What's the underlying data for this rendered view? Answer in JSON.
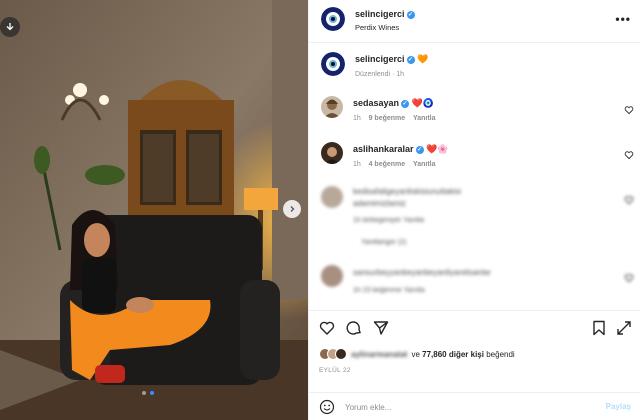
{
  "post": {
    "owner": "selincigerci",
    "location": "Perdix Wines",
    "verified": true
  },
  "caption": {
    "username": "selincigerci",
    "emoji": "🧡",
    "edited_label": "Düzenlendi · 1h"
  },
  "comments": [
    {
      "username": "sedasayan",
      "emoji": "❤️🧿",
      "time": "1h",
      "likes": "9 beğenme",
      "reply": "Yanıtla"
    },
    {
      "username": "aslihankaralar",
      "emoji": "❤️🌸",
      "time": "1h",
      "likes": "4 beğenme",
      "reply": "Yanıtla"
    }
  ],
  "blurred_comments": [
    {
      "line1": "kedisafaligeyanliskisiunuttakisi",
      "line2": "adamimizlamiz",
      "meta": "1h  birbegeniyer  Yanitla",
      "replies": "Yanitlarigor (2)"
    },
    {
      "line1": "sansurbeyyanbeyanbeyanliyarelisanlar",
      "meta": "1h  23 beğenme  Yanıtla"
    }
  ],
  "likes": {
    "blurred_user": "aylinarmanatat",
    "text_prefix": "ve",
    "count_text": "77,860 diğer kişi",
    "text_suffix": "beğendi"
  },
  "date": "EYLÜL 22",
  "comment_input": {
    "placeholder": "Yorum ekle..."
  },
  "post_button": "Paylaş",
  "colors": {
    "accent": "#3897f0",
    "heart": "#ed4956",
    "nazar_blue": "#14246b",
    "orange": "#f28a1e"
  },
  "icons": [
    "download-icon",
    "next-arrow-icon",
    "more-options-icon",
    "like-icon",
    "comment-icon",
    "share-icon",
    "save-icon",
    "emoji-icon",
    "verified-icon"
  ]
}
